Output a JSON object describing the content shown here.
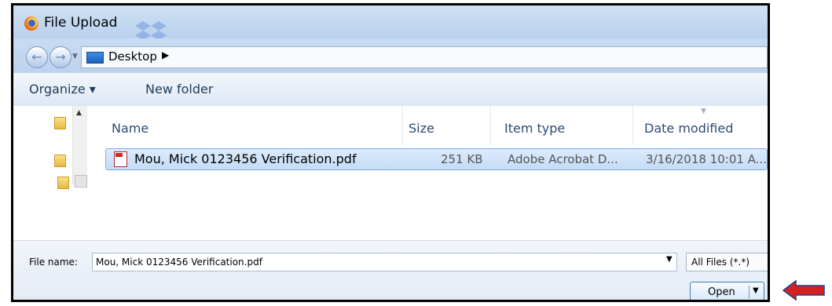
{
  "window": {
    "title": "File Upload"
  },
  "address": {
    "location": "Desktop",
    "separator": "▶"
  },
  "nav": {
    "back": "←",
    "forward": "→",
    "history_dropdown": "▼"
  },
  "toolbar": {
    "organize": "Organize ▾",
    "new_folder": "New folder"
  },
  "columns": {
    "name": "Name",
    "size": "Size",
    "type": "Item type",
    "date": "Date modified"
  },
  "file": {
    "name": "Mou, Mick 0123456 Verification.pdf",
    "size": "251 KB",
    "type": "Adobe Acrobat D...",
    "date": "3/16/2018 10:01 A..."
  },
  "scroll": {
    "up_arrow": "▲"
  },
  "bottom": {
    "file_name_label": "File name:",
    "file_name_value": "Mou, Mick 0123456 Verification.pdf",
    "dropdown_arrow": "▼",
    "filter": "All Files (*.*)",
    "open_label": "Open",
    "open_arrow": "▼"
  },
  "colors": {
    "titlebar": "#c3d8f0",
    "selected_row": "#cfe3fa",
    "open_border": "#3c7fb1",
    "red_arrow": "#d32020"
  }
}
